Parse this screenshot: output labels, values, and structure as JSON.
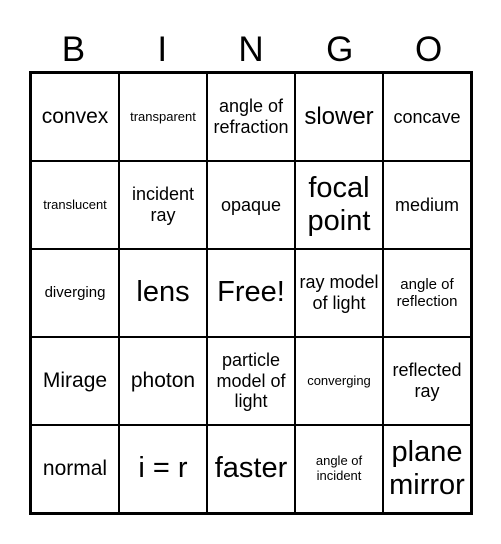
{
  "header": [
    "B",
    "I",
    "N",
    "G",
    "O"
  ],
  "cells": [
    {
      "text": "convex",
      "size": "s-lg"
    },
    {
      "text": "transparent",
      "size": "s-xs"
    },
    {
      "text": "angle of refraction",
      "size": "s-md"
    },
    {
      "text": "slower",
      "size": "s-xl"
    },
    {
      "text": "concave",
      "size": "s-md"
    },
    {
      "text": "translucent",
      "size": "s-xs"
    },
    {
      "text": "incident ray",
      "size": "s-md"
    },
    {
      "text": "opaque",
      "size": "s-md"
    },
    {
      "text": "focal point",
      "size": "s-xxl"
    },
    {
      "text": "medium",
      "size": "s-md"
    },
    {
      "text": "diverging",
      "size": "s-sm"
    },
    {
      "text": "lens",
      "size": "s-xxl"
    },
    {
      "text": "Free!",
      "size": "s-xxl"
    },
    {
      "text": "ray model of light",
      "size": "s-md"
    },
    {
      "text": "angle of reflection",
      "size": "s-sm"
    },
    {
      "text": "Mirage",
      "size": "s-lg"
    },
    {
      "text": "photon",
      "size": "s-lg"
    },
    {
      "text": "particle model of light",
      "size": "s-md"
    },
    {
      "text": "converging",
      "size": "s-xs"
    },
    {
      "text": "reflected ray",
      "size": "s-md"
    },
    {
      "text": "normal",
      "size": "s-lg"
    },
    {
      "text": "i = r",
      "size": "s-xxl"
    },
    {
      "text": "faster",
      "size": "s-xxl"
    },
    {
      "text": "angle of incident",
      "size": "s-xs"
    },
    {
      "text": "plane mirror",
      "size": "s-xxl"
    }
  ]
}
